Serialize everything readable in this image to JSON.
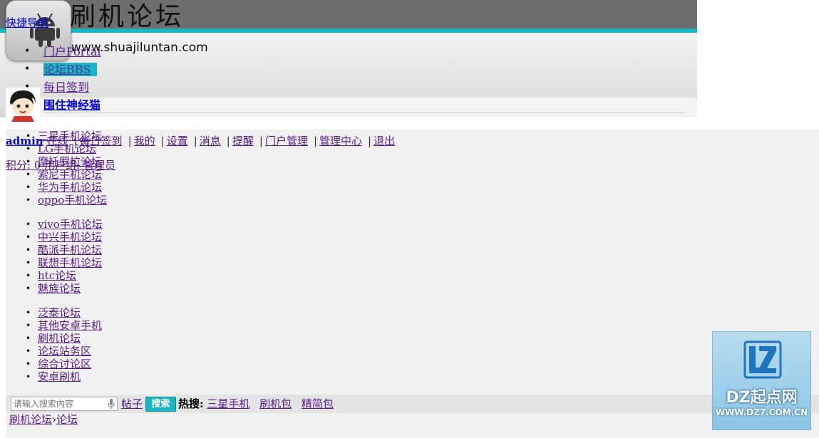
{
  "header": {
    "site_title": "刷机论坛",
    "site_domain": "www.shuajiluntan.com",
    "quick_nav": "快捷导航"
  },
  "main_nav": [
    {
      "label": "门户Portal"
    },
    {
      "label": "论坛BBS"
    },
    {
      "label": "每日签到"
    },
    {
      "label": "围住神经猫"
    }
  ],
  "userbar": {
    "username": "admin",
    "items": [
      "在线",
      "每日签到",
      "我的",
      "设置",
      "消息",
      "提醒",
      "门户管理",
      "管理中心",
      "退出"
    ]
  },
  "credits": {
    "label": "积分: 0",
    "group": "用户组: 管理员"
  },
  "forum_groups": [
    [
      "三星手机论坛",
      "LG手机论坛",
      "摩托罗拉论坛",
      "索尼手机论坛",
      "华为手机论坛",
      "oppo手机论坛"
    ],
    [
      "vivo手机论坛",
      "中兴手机论坛",
      "酷派手机论坛",
      "联想手机论坛",
      "htc论坛",
      "魅族论坛"
    ],
    [
      "泛泰论坛",
      "其他安卓手机",
      "刷机论坛",
      "论坛站务区",
      "综合讨论区",
      "安卓刷机"
    ]
  ],
  "search": {
    "placeholder": "请输入搜索内容",
    "type": "帖子",
    "button": "搜索",
    "hot_label": "热搜:",
    "hot_terms": [
      "三星手机",
      "刷机包",
      "精简包"
    ]
  },
  "breadcrumb": {
    "home": "刷机论坛",
    "sep": "›",
    "current": "论坛"
  },
  "watermark": {
    "title": "DZ起点网",
    "url": "WWW.DZ7.COM.CN"
  },
  "colors": {
    "accent": "#19b6c4",
    "banner": "#6e6e6e"
  }
}
